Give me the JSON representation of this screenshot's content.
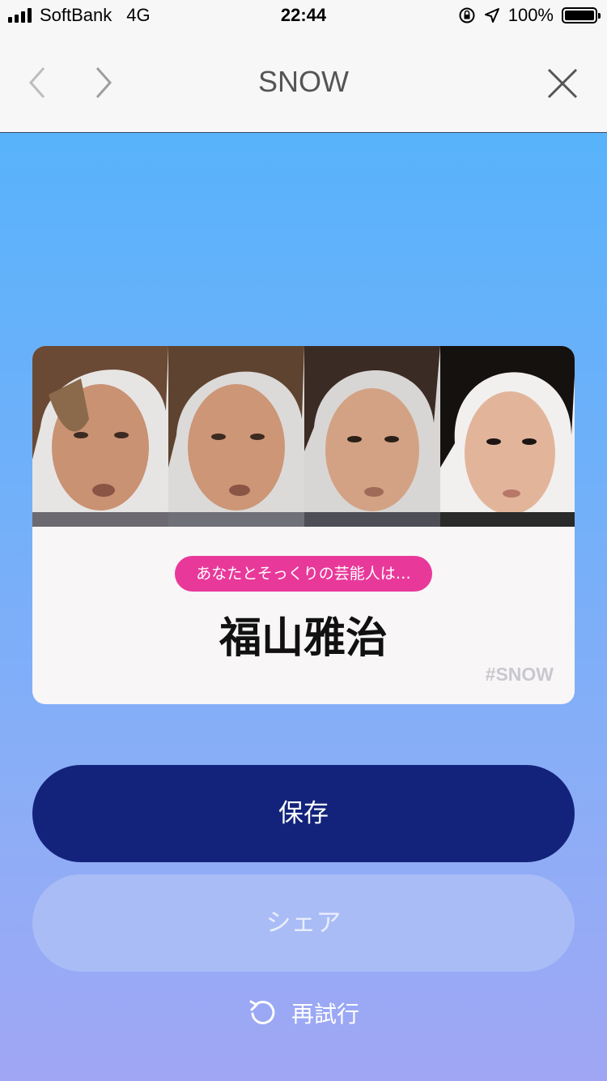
{
  "status_bar": {
    "carrier": "SoftBank",
    "network": "4G",
    "time": "22:44",
    "battery_percent": "100%"
  },
  "nav": {
    "title": "SNOW",
    "back_icon": "chevron-left-icon",
    "forward_icon": "chevron-right-icon",
    "close_icon": "close-icon"
  },
  "result": {
    "badge_text": "あなたとそっくりの芸能人は…",
    "celebrity_name": "福山雅治",
    "hashtag": "#SNOW"
  },
  "buttons": {
    "save_label": "保存",
    "share_label": "シェア",
    "retry_label": "再試行"
  },
  "colors": {
    "save_button": "#13237b",
    "share_button": "#aabcf6",
    "badge": "#e8399a",
    "gradient_top": "#58b3fb",
    "gradient_bottom": "#a0a6f4"
  }
}
